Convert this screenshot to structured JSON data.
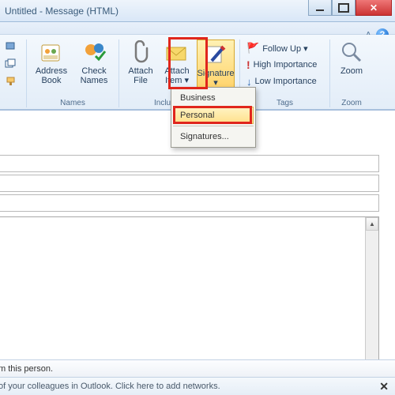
{
  "window": {
    "title": "Untitled - Message (HTML)"
  },
  "ribbon": {
    "clipboard": {
      "group_label": ""
    },
    "names": {
      "address_book": "Address\nBook",
      "check_names": "Check\nNames",
      "group_label": "Names"
    },
    "include": {
      "attach_file": "Attach\nFile",
      "attach_item": "Attach\nItem ▾",
      "signature": "Signature\n▾",
      "group_label": "Include"
    },
    "tags": {
      "follow_up": "Follow Up ▾",
      "high_importance": "High Importance",
      "low_importance": "Low Importance",
      "group_label": "Tags"
    },
    "zoom": {
      "zoom": "Zoom",
      "group_label": "Zoom"
    }
  },
  "signature_menu": {
    "items": [
      "Business",
      "Personal"
    ],
    "signatures_link": "Signatures..."
  },
  "status": {
    "line1": "m this person.",
    "line2": "of your colleagues in Outlook. Click here to add networks."
  }
}
